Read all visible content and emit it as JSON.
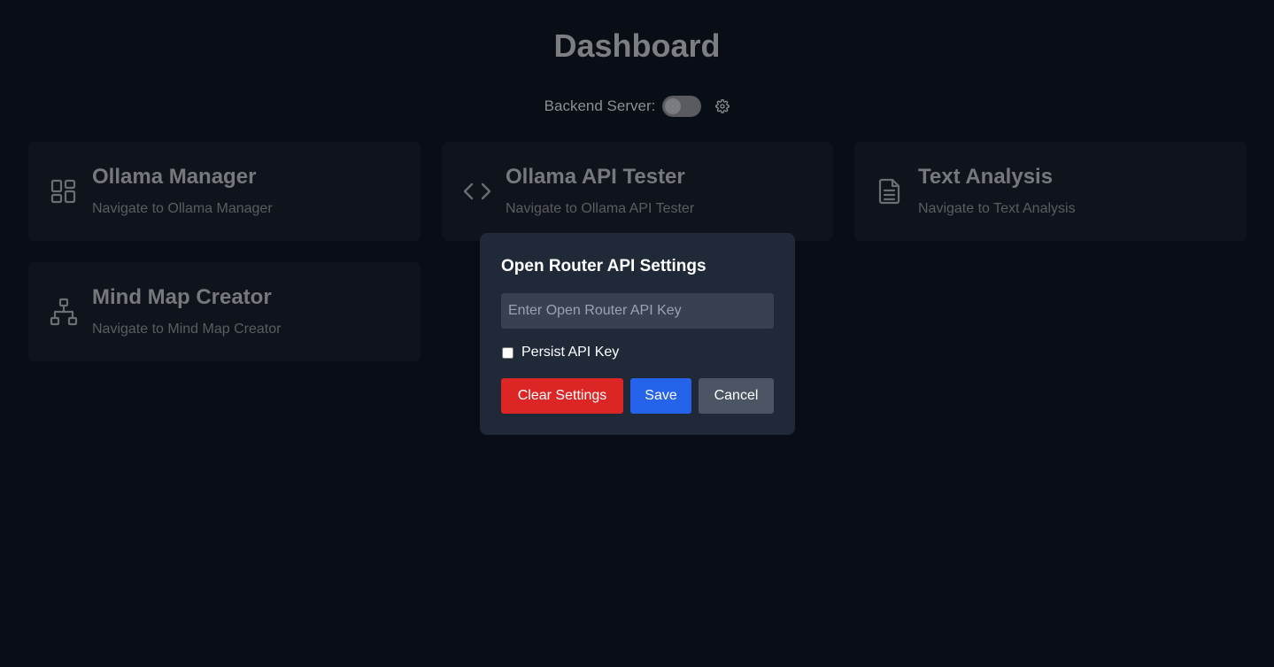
{
  "dashboard": {
    "title": "Dashboard",
    "backend_server_label": "Backend Server:",
    "backend_server_enabled": false
  },
  "cards": [
    {
      "title": "Ollama Manager",
      "subtitle": "Navigate to Ollama Manager",
      "icon": "dashboard-grid-icon"
    },
    {
      "title": "Ollama API Tester",
      "subtitle": "Navigate to Ollama API Tester",
      "icon": "code-brackets-icon"
    },
    {
      "title": "Text Analysis",
      "subtitle": "Navigate to Text Analysis",
      "icon": "document-icon"
    },
    {
      "title": "Mind Map Creator",
      "subtitle": "Navigate to Mind Map Creator",
      "icon": "sitemap-icon"
    }
  ],
  "modal": {
    "title": "Open Router API Settings",
    "api_key_value": "",
    "api_key_placeholder": "Enter Open Router API Key",
    "persist_label": "Persist API Key",
    "persist_checked": false,
    "clear_label": "Clear Settings",
    "save_label": "Save",
    "cancel_label": "Cancel"
  },
  "colors": {
    "background": "#090d16",
    "card": "#0f131c",
    "modal": "#1f2937",
    "danger": "#dc2626",
    "primary": "#2563eb",
    "neutral": "#4b5563"
  }
}
